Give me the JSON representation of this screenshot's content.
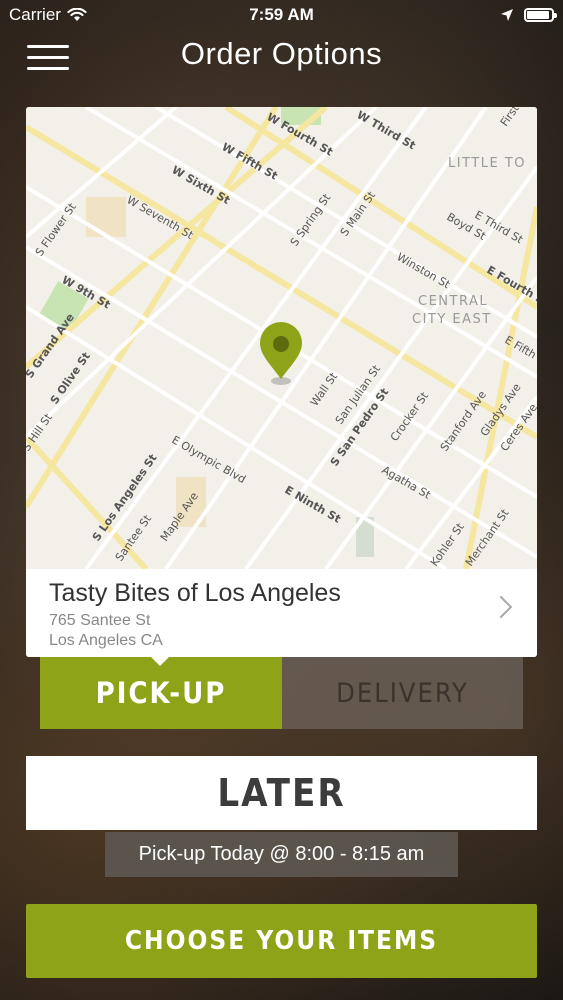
{
  "status": {
    "carrier": "Carrier",
    "time": "7:59 AM",
    "battery_level": 0.9,
    "icons": [
      "wifi-icon",
      "location-arrow-icon",
      "battery-icon"
    ]
  },
  "nav": {
    "title": "Order Options",
    "menu_icon": "hamburger-menu-icon"
  },
  "map": {
    "street_labels": [
      "W Fourth St",
      "W Third St",
      "W Fifth St",
      "W Sixth St",
      "W Seventh St",
      "S Flower St",
      "W 9th St",
      "S Grand Ave",
      "S Olive St",
      "S Spring St",
      "S Main St",
      "Winston St",
      "E Third St",
      "Boyd St",
      "E Fourth St",
      "Wall St",
      "San Julian St",
      "S San Pedro St",
      "Crocker St",
      "Stanford Ave",
      "Gladys Ave",
      "Ceres Ave",
      "E Fifth St",
      "E Olympic Blvd",
      "Maple Ave",
      "S Los Angeles St",
      "Santee St",
      "E Ninth St",
      "Agatha St",
      "Kohler St",
      "Merchant St",
      "S Hill St",
      "First St"
    ],
    "district_labels": [
      "LITTLE TO",
      "CENTRAL",
      "CITY EAST"
    ],
    "pin_icon": "map-pin-icon",
    "pin_color": "#8fa318"
  },
  "store": {
    "name": "Tasty Bites of Los Angeles",
    "address_line1": "765 Santee St",
    "address_line2": "Los Angeles CA"
  },
  "order_type": {
    "options": [
      "PICK-UP",
      "DELIVERY"
    ],
    "selected": "PICK-UP"
  },
  "timing": {
    "label": "LATER",
    "detail": "Pick-up Today @ 8:00 - 8:15 am"
  },
  "cta": {
    "label": "CHOOSE YOUR ITEMS"
  },
  "colors": {
    "accent": "#8fa318",
    "text_dark": "#3c3c3c"
  }
}
